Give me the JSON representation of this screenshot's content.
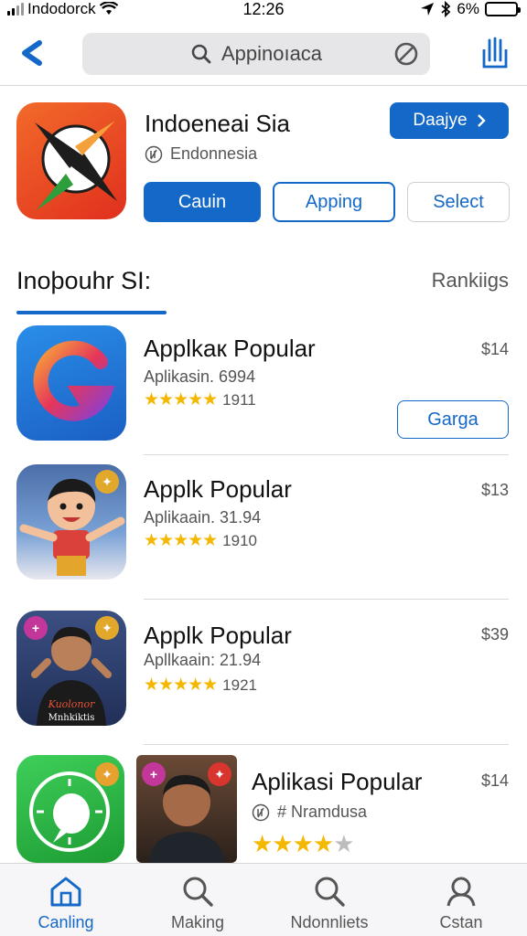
{
  "status_bar": {
    "carrier": "Indodorck",
    "time": "12:26",
    "battery": "6%",
    "battery_level": 0.06
  },
  "search": {
    "query": "Appinoıaca"
  },
  "featured": {
    "title": "Indoeneai Sia",
    "developer": "Endonnesia",
    "get_label": "Daajye",
    "buttons": [
      "Cauin",
      "Apping",
      "Select"
    ]
  },
  "section": {
    "title": "Inoþouhr SI:",
    "more": "Rankiigs"
  },
  "apps": [
    {
      "name": "Applkaк Popular",
      "meta": "Aplikasin. 6994",
      "rating_count": "1911",
      "stars": 5,
      "price": "$14",
      "action": "Garga"
    },
    {
      "name": "Applk Popular",
      "meta": "Aplikaain. 31.94",
      "rating_count": "1910",
      "stars": 5,
      "price": "$13"
    },
    {
      "name": "Applk Popular",
      "meta": "Apllkaain: 21.94",
      "rating_count": "1921",
      "stars": 5,
      "price": "$39",
      "icon_text": "Kuolonor Mnhkiktis"
    },
    {
      "name": "Aplikasi Popular",
      "meta": "# Nramdusa",
      "stars": 4,
      "price": "$14"
    }
  ],
  "tabs": [
    {
      "label": "Canling",
      "icon": "home-icon",
      "active": true
    },
    {
      "label": "Making",
      "icon": "search-icon",
      "active": false
    },
    {
      "label": "Ndonnliets",
      "icon": "search-icon",
      "active": false
    },
    {
      "label": "Cstan",
      "icon": "person-icon",
      "active": false
    }
  ],
  "colors": {
    "accent": "#1468c8",
    "star": "#f5b800"
  }
}
